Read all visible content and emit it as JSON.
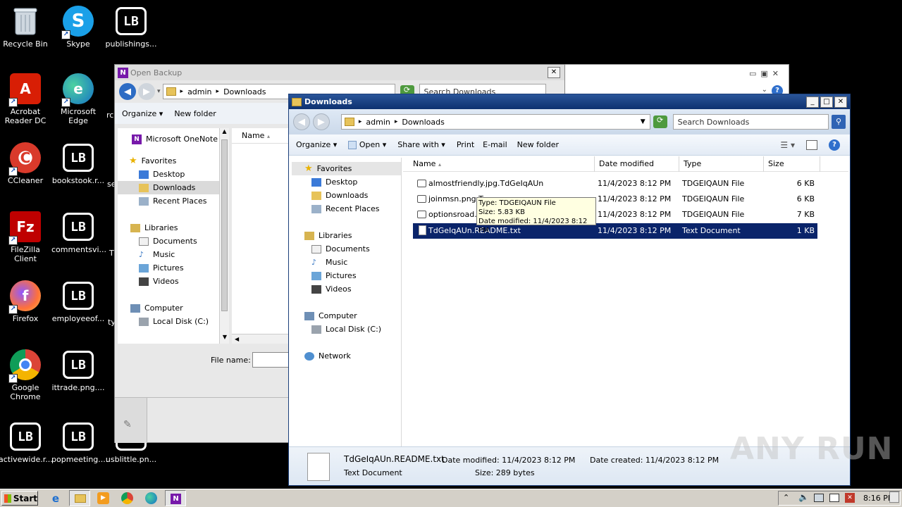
{
  "desktop": {
    "icons": [
      {
        "label": "Recycle Bin",
        "icon": "recycle-bin-icon"
      },
      {
        "label": "Skype",
        "icon": "skype-icon"
      },
      {
        "label": "publishings...",
        "icon": "ransom-file-icon"
      },
      {
        "label": "Acrobat Reader DC",
        "icon": "acrobat-icon"
      },
      {
        "label": "Microsoft Edge",
        "icon": "edge-icon"
      },
      {
        "label": "CCleaner",
        "icon": "ccleaner-icon"
      },
      {
        "label": "bookstook.r...",
        "icon": "ransom-file-icon"
      },
      {
        "label": "FileZilla Client",
        "icon": "filezilla-icon"
      },
      {
        "label": "commentsvi...",
        "icon": "ransom-file-icon"
      },
      {
        "label": "Firefox",
        "icon": "firefox-icon"
      },
      {
        "label": "employeeof...",
        "icon": "ransom-file-icon"
      },
      {
        "label": "Google Chrome",
        "icon": "chrome-icon"
      },
      {
        "label": "ittrade.png....",
        "icon": "ransom-file-icon"
      },
      {
        "label": "activewide.r...",
        "icon": "ransom-file-icon"
      },
      {
        "label": "popmeeting....",
        "icon": "ransom-file-icon"
      },
      {
        "label": "usblittle.pn...",
        "icon": "ransom-file-icon"
      }
    ],
    "partial_labels": [
      "rc",
      "se",
      "T",
      "ty"
    ]
  },
  "open_backup": {
    "title": "Open Backup",
    "breadcrumb": [
      "admin",
      "Downloads"
    ],
    "search_placeholder": "Search Downloads",
    "toolbar": {
      "organize": "Organize",
      "new_folder": "New folder"
    },
    "nav": {
      "app": "Microsoft OneNote",
      "favorites": "Favorites",
      "favorites_items": [
        "Desktop",
        "Downloads",
        "Recent Places"
      ],
      "libraries": "Libraries",
      "libraries_items": [
        "Documents",
        "Music",
        "Pictures",
        "Videos"
      ],
      "computer": "Computer",
      "computer_items": [
        "Local Disk (C:)"
      ]
    },
    "column_name": "Name",
    "file_name_label": "File name:"
  },
  "downloads": {
    "title": "Downloads",
    "breadcrumb": [
      "admin",
      "Downloads"
    ],
    "search_placeholder": "Search Downloads",
    "toolbar": {
      "organize": "Organize",
      "open": "Open",
      "share_with": "Share with",
      "print": "Print",
      "email": "E-mail",
      "new_folder": "New folder"
    },
    "nav": {
      "favorites": "Favorites",
      "favorites_items": [
        "Desktop",
        "Downloads",
        "Recent Places"
      ],
      "libraries": "Libraries",
      "libraries_items": [
        "Documents",
        "Music",
        "Pictures",
        "Videos"
      ],
      "computer": "Computer",
      "computer_items": [
        "Local Disk (C:)"
      ],
      "network": "Network"
    },
    "columns": [
      "Name",
      "Date modified",
      "Type",
      "Size"
    ],
    "files": [
      {
        "name": "almostfriendly.jpg.TdGeIqAUn",
        "date": "11/4/2023 8:12 PM",
        "type": "TDGEIQAUN File",
        "size": "6 KB"
      },
      {
        "name": "joinmsn.png.T",
        "date": "11/4/2023 8:12 PM",
        "type": "TDGEIQAUN File",
        "size": "6 KB"
      },
      {
        "name": "optionsroad.p",
        "date": "11/4/2023 8:12 PM",
        "type": "TDGEIQAUN File",
        "size": "7 KB"
      },
      {
        "name": "TdGeIqAUn.README.txt",
        "date": "11/4/2023 8:12 PM",
        "type": "Text Document",
        "size": "1 KB"
      }
    ],
    "tooltip": {
      "type": "Type: TDGEIQAUN File",
      "size": "Size: 5.83 KB",
      "date": "Date modified: 11/4/2023 8:12 PM"
    },
    "details": {
      "name": "TdGeIqAUn.README.txt",
      "kind": "Text Document",
      "date_modified": "Date modified: 11/4/2023 8:12 PM",
      "size": "Size: 289 bytes",
      "date_created": "Date created: 11/4/2023 8:12 PM"
    }
  },
  "watermark": "ANY RUN",
  "taskbar": {
    "start": "Start",
    "clock": "8:16 PM"
  }
}
